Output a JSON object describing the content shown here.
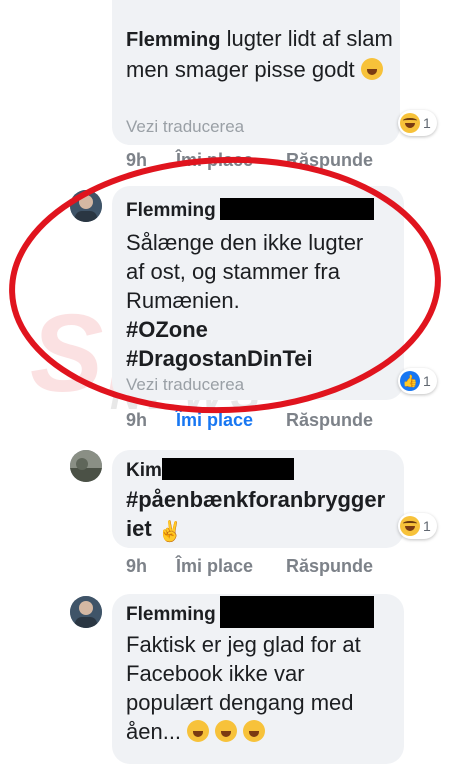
{
  "watermark": {
    "main": "SPY",
    "sub": "NEWS"
  },
  "comments": [
    {
      "author": "Flemming",
      "text": "lugter lidt af slam men smager pisse godt",
      "translate": "Vezi traducerea",
      "reaction": {
        "type": "haha",
        "count": "1"
      },
      "time": "9h",
      "like": "Îmi place",
      "reply": "Răspunde"
    },
    {
      "author": "Flemming",
      "lines": [
        "Sålænge den ikke lugter",
        "af ost, og stammer fra",
        "Rumænien."
      ],
      "hashtags": [
        "#OZone",
        "#DragostanDinTei"
      ],
      "translate": "Vezi traducerea",
      "reaction": {
        "type": "like",
        "count": "1"
      },
      "time": "9h",
      "like": "Îmi place",
      "reply": "Răspunde"
    },
    {
      "author": "Kim",
      "lines": [
        "#påenbænkforanbrygger",
        "iet"
      ],
      "reaction": {
        "type": "haha",
        "count": "1"
      },
      "time": "9h",
      "like": "Îmi place",
      "reply": "Răspunde"
    },
    {
      "author": "Flemming",
      "lines": [
        "Faktisk er jeg glad for at",
        "Facebook ikke var",
        "populært dengang med",
        "åen..."
      ]
    }
  ],
  "colors": {
    "annotation_ring": "#e0141e",
    "link_blue": "#1877f2"
  }
}
